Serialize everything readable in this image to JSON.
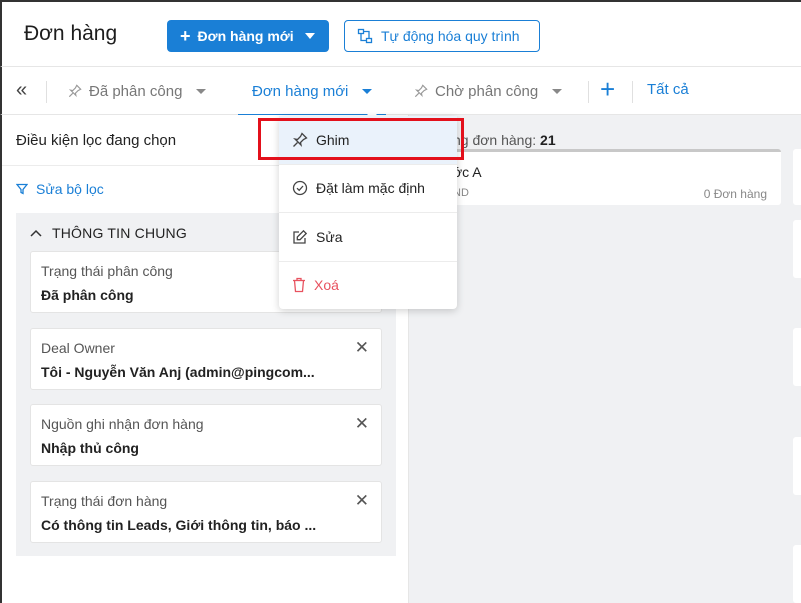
{
  "header": {
    "title": "Đơn hàng",
    "new_order_button": "Đơn hàng mới",
    "automation_button": "Tự động hóa quy trình"
  },
  "tabs": {
    "items": [
      {
        "label": "Đã phân công",
        "pinned": true,
        "active": false
      },
      {
        "label": "Đơn hàng mới",
        "pinned": false,
        "active": true
      },
      {
        "label": "Chờ phân công",
        "pinned": true,
        "active": false
      }
    ],
    "all_label": "Tất cả"
  },
  "filter_panel": {
    "title": "Điều kiện lọc đang chọn",
    "edit_filter_label": "Sửa bộ lọc",
    "section_title": "THÔNG TIN CHUNG",
    "conditions": [
      {
        "label": "Trạng thái phân công",
        "value": "Đã phân công",
        "removable": false
      },
      {
        "label": "Deal Owner",
        "value": "Tôi - Nguyễn Văn Anj (admin@pingcom...",
        "removable": true
      },
      {
        "label": "Nguồn ghi nhận đơn hàng",
        "value": "Nhập thủ công",
        "removable": true
      },
      {
        "label": "Trạng thái đơn hàng",
        "value": "Có thông tin Leads, Giới thông tin, báo ...",
        "removable": true
      }
    ]
  },
  "kanban": {
    "column_header_prefix": "ng đơn hàng:",
    "column_header_count": "21",
    "stage_name": "ớc A",
    "stage_currency": "ND",
    "stage_order_count": "0 Đơn hàng"
  },
  "dropdown_menu": {
    "items": [
      {
        "label": "Ghim",
        "icon": "pin-icon"
      },
      {
        "label": "Đặt làm mặc định",
        "icon": "check-circle-icon"
      },
      {
        "label": "Sửa",
        "icon": "edit-icon"
      },
      {
        "label": "Xoá",
        "icon": "trash-icon"
      }
    ]
  },
  "colors": {
    "primary": "#1a7fd6",
    "danger": "#e8525f",
    "highlight": "#e3101b",
    "panel_bg": "#f0f1f3"
  }
}
